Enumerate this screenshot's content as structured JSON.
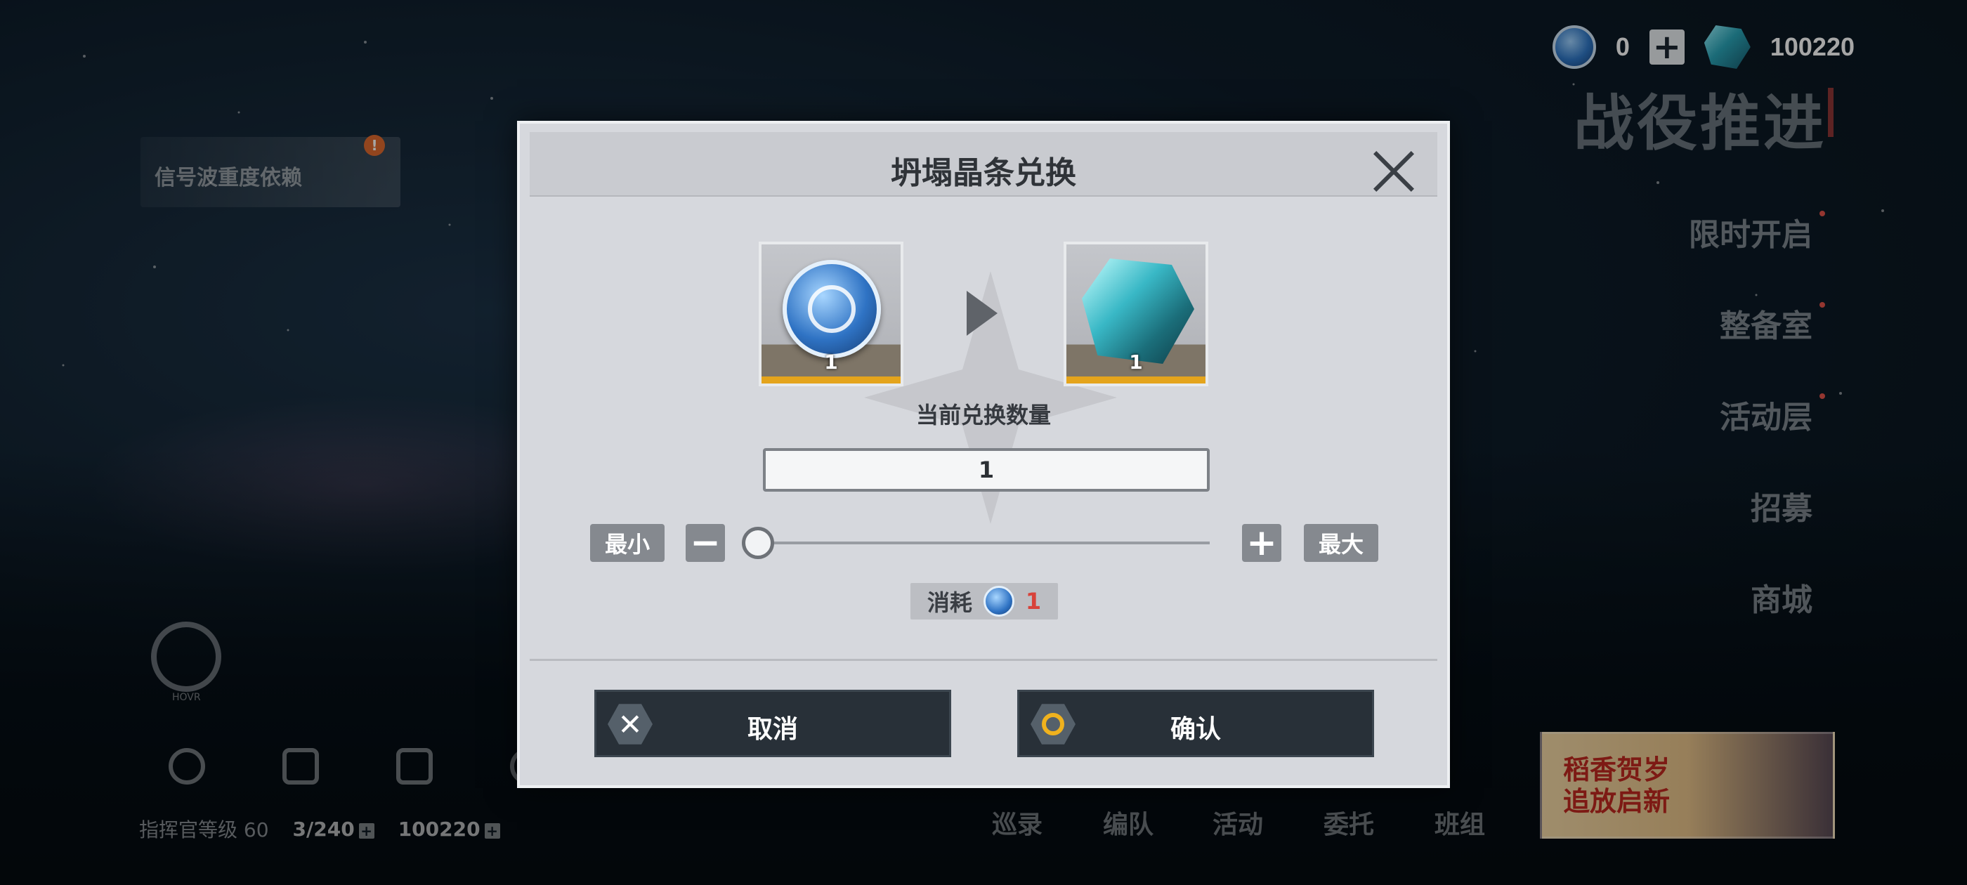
{
  "currency": {
    "coin_count": "0",
    "gem_count": "100220",
    "plus_label": "+"
  },
  "menu": {
    "title": "战役推进",
    "items": [
      "限时开启",
      "整备室",
      "活动层",
      "招募",
      "商城"
    ]
  },
  "left": {
    "notice_text": "信号波重度依赖",
    "notice_badge": "!",
    "radio_label": "HOVR"
  },
  "status": {
    "commander_level": "指挥官等级 60",
    "stamina": "3/240",
    "gems": "100220",
    "plus": "+"
  },
  "nav": [
    "巡录",
    "编队",
    "活动",
    "委托",
    "班组"
  ],
  "banner": {
    "line1": "稻香贺岁",
    "line2": "追放启新"
  },
  "dialog": {
    "title": "坍塌晶条兑换",
    "from_count": "1",
    "to_count": "1",
    "qty_label": "当前兑换数量",
    "qty_value": "1",
    "min_label": "最小",
    "max_label": "最大",
    "minus": "−",
    "plus": "+",
    "slider_value": 1,
    "cost_label": "消耗",
    "cost_value": "1",
    "cancel_label": "取消",
    "confirm_label": "确认",
    "colors": {
      "accent_yellow": "#e4a41c",
      "cost_red": "#d8423a",
      "button_dark": "#283038"
    }
  }
}
